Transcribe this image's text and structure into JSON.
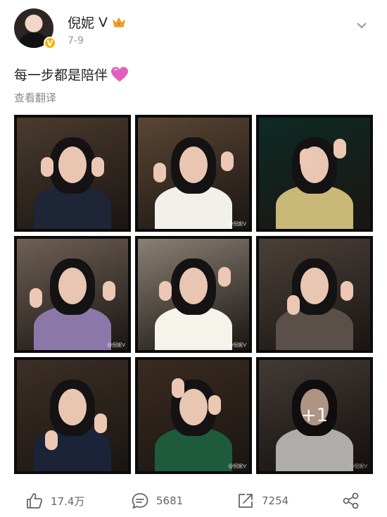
{
  "post": {
    "author": "倪妮",
    "verified_letter": "V",
    "date": "7-9",
    "text": "每一步都是陪伴",
    "translate": "查看翻译"
  },
  "photos": [
    {
      "bg": "#4a3b2e",
      "outfit": "#1d2536",
      "more": ""
    },
    {
      "bg": "#5a4634",
      "outfit": "#f2f0ea",
      "more": ""
    },
    {
      "bg": "#0e2a24",
      "outfit": "#c9b877",
      "more": ""
    },
    {
      "bg": "#6e6055",
      "outfit": "#8c78a8",
      "more": ""
    },
    {
      "bg": "#8a8074",
      "outfit": "#f6f3ea",
      "more": ""
    },
    {
      "bg": "#4a4039",
      "outfit": "#5a5049",
      "more": ""
    },
    {
      "bg": "#3c2f26",
      "outfit": "#1a2338",
      "more": ""
    },
    {
      "bg": "#3a2b20",
      "outfit": "#1e5a3c",
      "more": ""
    },
    {
      "bg": "#5a4e48",
      "outfit": "#e9e7e2",
      "more": "+1"
    }
  ],
  "watermark": "@倪妮V",
  "actions": {
    "likes": "17.4万",
    "comments": "5681",
    "reposts": "7254"
  },
  "colors": {
    "verified_badge": "#f4b400",
    "heart": "#e060c0",
    "crown": "#f5a623"
  }
}
